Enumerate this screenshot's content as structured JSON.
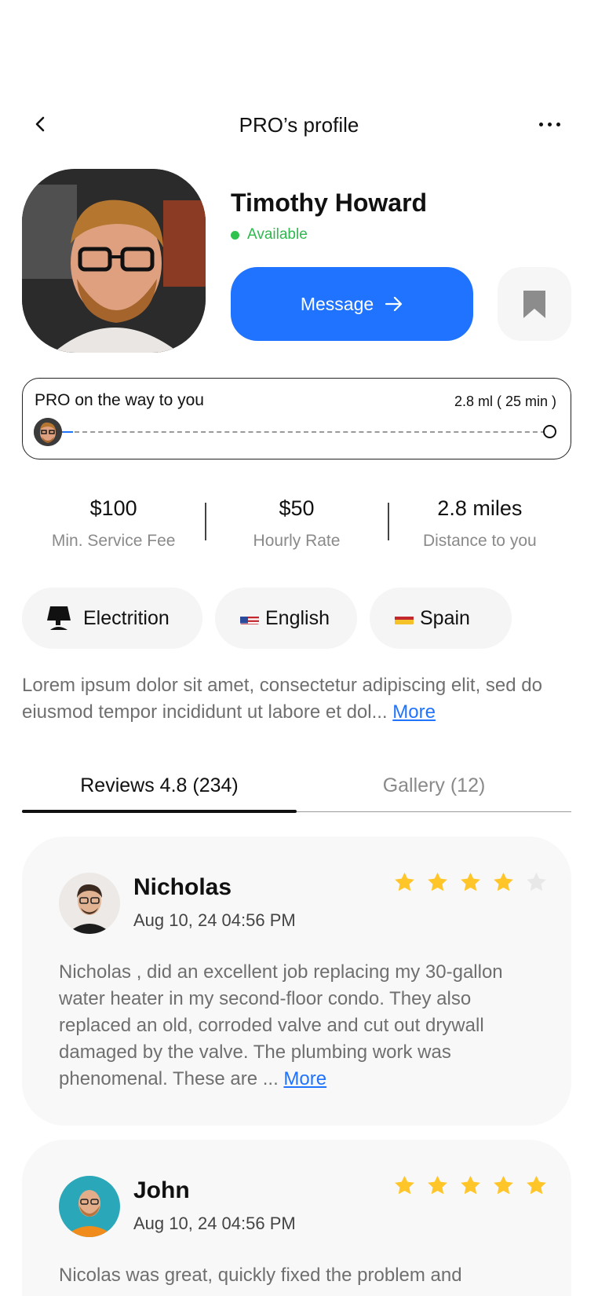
{
  "header": {
    "title": "PRO’s profile"
  },
  "pro": {
    "name": "Timothy Howard",
    "status": "Available",
    "message_label": "Message"
  },
  "tracking": {
    "title": "PRO on the way to you",
    "distance": "2.8 ml ( 25 min )",
    "progress_fraction": 0.02
  },
  "stats": [
    {
      "value": "$100",
      "label": "Min. Service Fee"
    },
    {
      "value": "$50",
      "label": "Hourly Rate"
    },
    {
      "value": "2.8 miles",
      "label": "Distance to you"
    }
  ],
  "chips": {
    "profession": "Electrition",
    "language": "English",
    "country": "Spain"
  },
  "bio": {
    "text": "Lorem ipsum dolor sit amet, consectetur adipiscing elit, sed do eiusmod tempor incididunt ut labore et dol...",
    "more": "More"
  },
  "tabs": {
    "reviews": "Reviews 4.8 (234)",
    "gallery": "Gallery (12)",
    "active": "reviews"
  },
  "reviews": [
    {
      "name": "Nicholas",
      "date": "Aug 10, 24 04:56 PM",
      "rating": 4,
      "text": "Nicholas , did an excellent job replacing my 30-gallon water heater in my second-floor condo. They also replaced an old, corroded valve and cut out drywall damaged by the valve. The plumbing work was phenomenal. These are ...",
      "more": "More"
    },
    {
      "name": "John",
      "date": "Aug 10, 24 04:56 PM",
      "rating": 5,
      "text": "Nicolas was  great, quickly fixed the problem and"
    }
  ],
  "colors": {
    "accent": "#1f73ff",
    "available": "#2fc24f",
    "star": "#ffc529",
    "star_empty": "#e8e8e8"
  },
  "icons": {
    "back": "chevron-left-icon",
    "more": "more-horizontal-icon",
    "message_arrow": "arrow-right-icon",
    "bookmark": "bookmark-icon",
    "profession": "lamp-icon",
    "language_flag": "us-flag-icon",
    "country_flag": "spain-flag-icon",
    "star": "star-icon"
  }
}
